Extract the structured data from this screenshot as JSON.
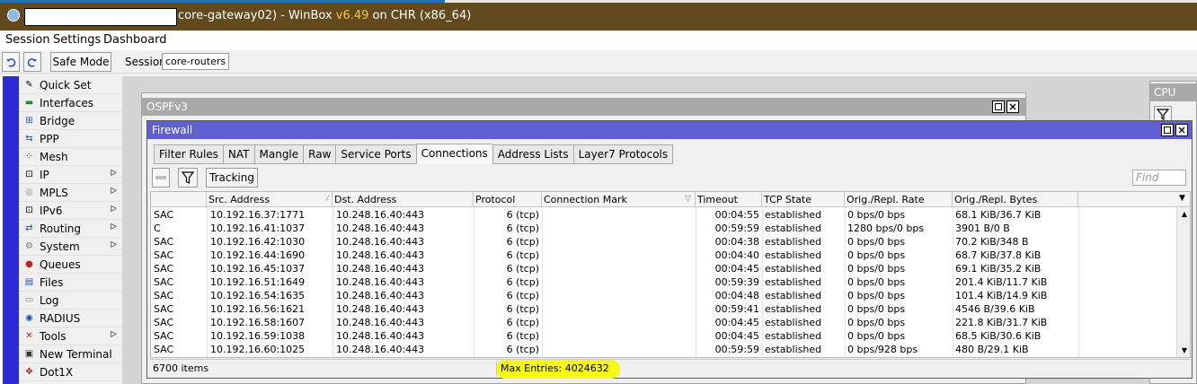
{
  "window": {
    "title": "core-gateway02) - WinBox ",
    "version": "v6.49",
    "title_suffix": " on CHR (x86_64)"
  },
  "menu": [
    "Session",
    "Settings",
    "Dashboard"
  ],
  "toolbar": {
    "safe_mode": "Safe Mode",
    "session_label": "Session:",
    "session_value": "core-routers"
  },
  "sidebar": {
    "items": [
      {
        "label": "Quick Set",
        "icon": "wand-icon",
        "glyph": "✎",
        "submenu": false
      },
      {
        "label": "Interfaces",
        "icon": "interfaces-icon",
        "glyph": "▬",
        "submenu": false
      },
      {
        "label": "Bridge",
        "icon": "bridge-icon",
        "glyph": "⊞",
        "submenu": false
      },
      {
        "label": "PPP",
        "icon": "ppp-icon",
        "glyph": "⇆",
        "submenu": false
      },
      {
        "label": "Mesh",
        "icon": "mesh-icon",
        "glyph": "⁘",
        "submenu": false
      },
      {
        "label": "IP",
        "icon": "ip-icon",
        "glyph": "⊡",
        "submenu": true
      },
      {
        "label": "MPLS",
        "icon": "mpls-icon",
        "glyph": "◎",
        "submenu": true
      },
      {
        "label": "IPv6",
        "icon": "ipv6-icon",
        "glyph": "⊡",
        "submenu": true
      },
      {
        "label": "Routing",
        "icon": "routing-icon",
        "glyph": "⇄",
        "submenu": true
      },
      {
        "label": "System",
        "icon": "gear-icon",
        "glyph": "⚙",
        "submenu": true
      },
      {
        "label": "Queues",
        "icon": "queues-icon",
        "glyph": "●",
        "submenu": false
      },
      {
        "label": "Files",
        "icon": "folder-icon",
        "glyph": "▤",
        "submenu": false
      },
      {
        "label": "Log",
        "icon": "log-icon",
        "glyph": "▭",
        "submenu": false
      },
      {
        "label": "RADIUS",
        "icon": "radius-icon",
        "glyph": "◉",
        "submenu": false
      },
      {
        "label": "Tools",
        "icon": "tools-icon",
        "glyph": "✕",
        "submenu": true
      },
      {
        "label": "New Terminal",
        "icon": "terminal-icon",
        "glyph": "▣",
        "submenu": false
      },
      {
        "label": "Dot1X",
        "icon": "dot1x-icon",
        "glyph": "✥",
        "submenu": false
      }
    ]
  },
  "ospf_window": {
    "title": "OSPFv3"
  },
  "cpu_window": {
    "title": "CPU"
  },
  "firewall": {
    "title": "Firewall",
    "tabs": [
      {
        "label": "Filter Rules",
        "active": false
      },
      {
        "label": "NAT",
        "active": false
      },
      {
        "label": "Mangle",
        "active": false
      },
      {
        "label": "Raw",
        "active": false
      },
      {
        "label": "Service Ports",
        "active": false
      },
      {
        "label": "Connections",
        "active": true
      },
      {
        "label": "Address Lists",
        "active": false
      },
      {
        "label": "Layer7 Protocols",
        "active": false
      }
    ],
    "tracking_label": "Tracking",
    "find_placeholder": "Find",
    "columns": [
      "",
      "Src. Address",
      "Dst. Address",
      "Protocol",
      "Connection Mark",
      "Timeout",
      "TCP State",
      "Orig./Repl. Rate",
      "Orig./Repl. Bytes"
    ],
    "rows": [
      [
        "SAC",
        "10.192.16.37:1771",
        "10.248.16.40:443",
        "6 (tcp)",
        "",
        "00:04:55",
        "established",
        "0 bps/0 bps",
        "68.1 KiB/36.7 KiB"
      ],
      [
        "C",
        "10.192.16.41:1037",
        "10.248.16.40:443",
        "6 (tcp)",
        "",
        "00:59:59",
        "established",
        "1280 bps/0 bps",
        "3901 B/0 B"
      ],
      [
        "SAC",
        "10.192.16.42:1030",
        "10.248.16.40:443",
        "6 (tcp)",
        "",
        "00:04:38",
        "established",
        "0 bps/0 bps",
        "70.2 KiB/348 B"
      ],
      [
        "SAC",
        "10.192.16.44:1690",
        "10.248.16.40:443",
        "6 (tcp)",
        "",
        "00:04:40",
        "established",
        "0 bps/0 bps",
        "68.7 KiB/37.8 KiB"
      ],
      [
        "SAC",
        "10.192.16.45:1037",
        "10.248.16.40:443",
        "6 (tcp)",
        "",
        "00:04:45",
        "established",
        "0 bps/0 bps",
        "69.1 KiB/35.2 KiB"
      ],
      [
        "SAC",
        "10.192.16.51:1649",
        "10.248.16.40:443",
        "6 (tcp)",
        "",
        "00:59:39",
        "established",
        "0 bps/0 bps",
        "201.4 KiB/11.7 KiB"
      ],
      [
        "SAC",
        "10.192.16.54:1635",
        "10.248.16.40:443",
        "6 (tcp)",
        "",
        "00:04:48",
        "established",
        "0 bps/0 bps",
        "101.4 KiB/14.9 KiB"
      ],
      [
        "SAC",
        "10.192.16.56:1621",
        "10.248.16.40:443",
        "6 (tcp)",
        "",
        "00:59:41",
        "established",
        "0 bps/0 bps",
        "4546 B/39.6 KiB"
      ],
      [
        "SAC",
        "10.192.16.58:1607",
        "10.248.16.40:443",
        "6 (tcp)",
        "",
        "00:04:45",
        "established",
        "0 bps/0 bps",
        "221.8 KiB/31.7 KiB"
      ],
      [
        "SAC",
        "10.192.16.59:1038",
        "10.248.16.40:443",
        "6 (tcp)",
        "",
        "00:04:45",
        "established",
        "0 bps/0 bps",
        "68.5 KiB/30.6 KiB"
      ],
      [
        "SAC",
        "10.192.16.60:1025",
        "10.248.16.40:443",
        "6 (tcp)",
        "",
        "00:59:59",
        "established",
        "0 bps/928 bps",
        "480 B/29.1 KiB"
      ]
    ],
    "status_items": "6700 items",
    "status_max": "Max Entries: 4024632",
    "highlight_color": "#f7f719"
  }
}
